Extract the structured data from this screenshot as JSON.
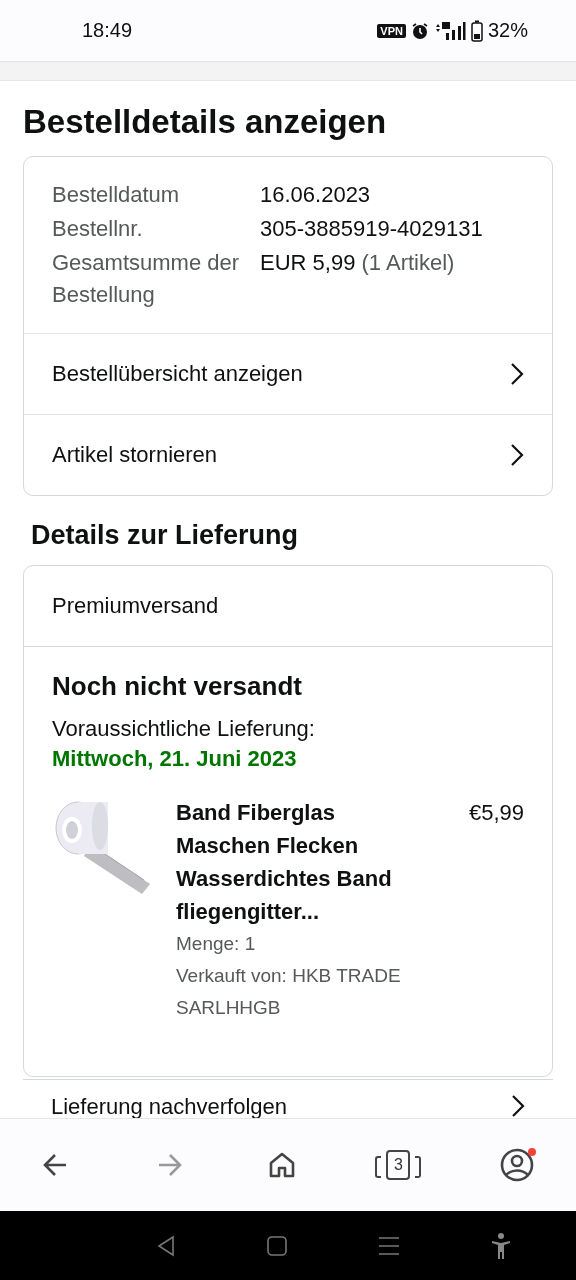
{
  "status_bar": {
    "time": "18:49",
    "vpn": "VPN",
    "battery": "32%"
  },
  "title": "Bestelldetails anzeigen",
  "order_summary": {
    "fields": [
      {
        "label": "Bestelldatum",
        "value": "16.06.2023"
      },
      {
        "label": "Bestellnr.",
        "value": "305-3885919-4029131"
      },
      {
        "label": "Gesamtsumme der Bestellung",
        "value": "EUR 5,99",
        "note": "(1 Artikel)"
      }
    ],
    "links": [
      "Bestellübersicht anzeigen",
      "Artikel stornieren"
    ]
  },
  "delivery": {
    "heading": "Details zur Lieferung",
    "shipping_method": "Premiumversand",
    "status": "Noch nicht versandt",
    "eta_label": "Voraussichtliche Lieferung:",
    "eta_date": "Mittwoch, 21. Juni 2023",
    "item": {
      "kind": "picture",
      "title": "Band Fiberglas Maschen Flecken Wasserdichtes Band fliegengitter...",
      "price": "€5,99",
      "quantity": "Menge: 1",
      "seller": "Verkauft von: HKB TRADE SARLHHGB"
    },
    "links": [
      "Lieferung nachverfolgen"
    ]
  },
  "bottom_nav": [
    {
      "kind": "back",
      "disabled": false
    },
    {
      "kind": "forward",
      "disabled": true
    },
    {
      "kind": "home",
      "disabled": false
    },
    {
      "kind": "tabs",
      "count": "3",
      "disabled": false
    },
    {
      "kind": "account",
      "notification": true,
      "disabled": false
    }
  ]
}
